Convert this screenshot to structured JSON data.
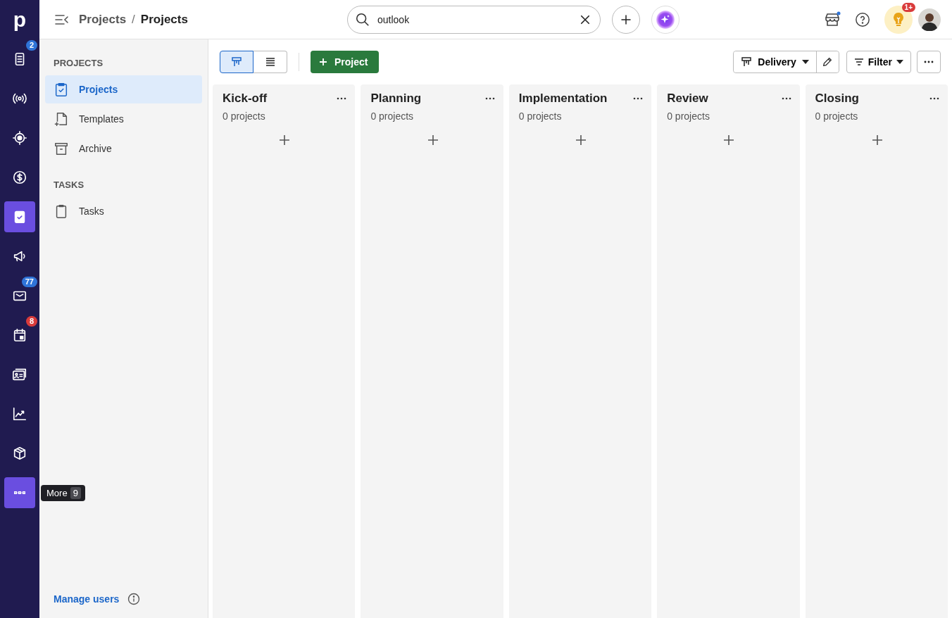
{
  "rail": {
    "logo": "p",
    "items": [
      {
        "selected": false,
        "badge": "2",
        "color": "#2f74d8"
      },
      {
        "selected": false
      },
      {
        "selected": false
      },
      {
        "selected": false
      },
      {
        "selected": true
      },
      {
        "selected": false
      },
      {
        "selected": false,
        "badge": "77",
        "color": "#2f74d8"
      },
      {
        "selected": false,
        "badge": "8",
        "color": "#d93b3b"
      },
      {
        "selected": false
      },
      {
        "selected": false
      },
      {
        "selected": false
      },
      {
        "selected": true,
        "tooltip": {
          "label": "More",
          "count": "9"
        }
      }
    ]
  },
  "topbar": {
    "breadcrumb": [
      "Projects",
      "Projects"
    ],
    "separator": "/",
    "search": {
      "value": "outlook"
    },
    "notification_badge": "1+"
  },
  "sidebar": {
    "sections": [
      {
        "title": "PROJECTS",
        "items": [
          {
            "label": "Projects",
            "selected": true
          },
          {
            "label": "Templates",
            "selected": false
          },
          {
            "label": "Archive",
            "selected": false
          }
        ]
      },
      {
        "title": "TASKS",
        "items": [
          {
            "label": "Tasks",
            "selected": false
          }
        ]
      }
    ],
    "footer_link": "Manage users"
  },
  "toolbar": {
    "views": [
      {
        "selected": true
      },
      {
        "selected": false
      }
    ],
    "add_button": "Project",
    "pipeline": "Delivery",
    "filter": "Filter"
  },
  "columns": [
    {
      "title": "Kick-off",
      "count": "0 projects"
    },
    {
      "title": "Planning",
      "count": "0 projects"
    },
    {
      "title": "Implementation",
      "count": "0 projects"
    },
    {
      "title": "Review",
      "count": "0 projects"
    },
    {
      "title": "Closing",
      "count": "0 projects"
    }
  ]
}
